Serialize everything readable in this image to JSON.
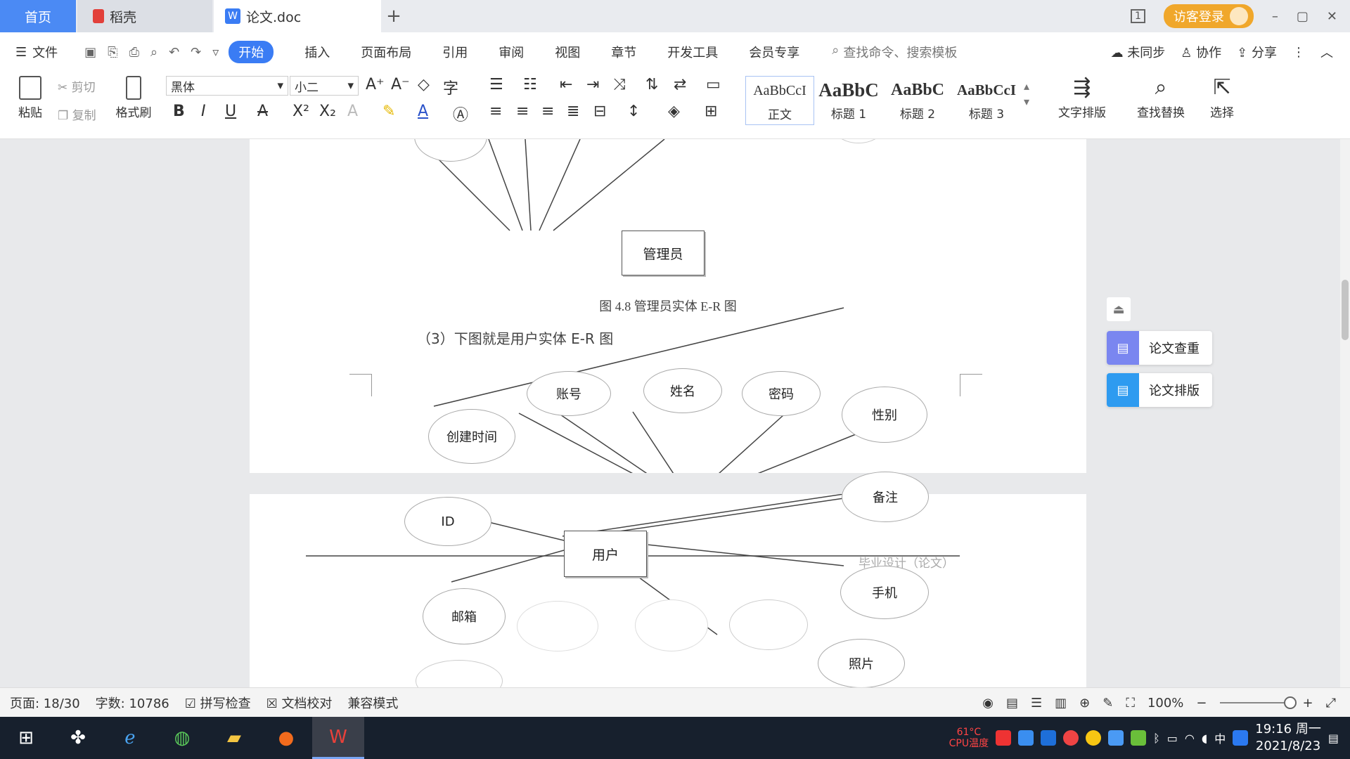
{
  "tabs": {
    "home": "首页",
    "daoke": "稻壳",
    "doc": "论文.doc",
    "add": "+",
    "doc_icon": "W"
  },
  "window": {
    "login": "访客登录",
    "layout_icon": "1",
    "minimize": "–",
    "restore": "▢",
    "close": "✕"
  },
  "menu": {
    "file": "文件",
    "start": "开始",
    "items": [
      "插入",
      "页面布局",
      "引用",
      "审阅",
      "视图",
      "章节",
      "开发工具",
      "会员专享"
    ],
    "search": "查找命令、搜索模板",
    "sync": "未同步",
    "collab": "协作",
    "share": "分享"
  },
  "ribbon": {
    "paste": "粘贴",
    "cut": "剪切",
    "copy": "复制",
    "format_painter": "格式刷",
    "font_name": "黑体",
    "font_size": "小二",
    "styles": [
      {
        "preview": "AaBbCcI",
        "label": "正文"
      },
      {
        "preview": "AaBbC",
        "label": "标题 1"
      },
      {
        "preview": "AaBbC",
        "label": "标题 2"
      },
      {
        "preview": "AaBbCcI",
        "label": "标题 3"
      }
    ],
    "text_layout": "文字排版",
    "find_replace": "查找替换",
    "select": "选择",
    "bold": "B",
    "italic": "I",
    "underline": "U",
    "superscript": "X²",
    "subscript": "X₂"
  },
  "document": {
    "admin_entity": "管理员",
    "fig_caption": "图 4.8  管理员实体 E-R 图",
    "para": "（3）下图就是用户实体 E-R 图",
    "user_entity": "用户",
    "attributes": {
      "account": "账号",
      "name": "姓名",
      "password": "密码",
      "gender": "性别",
      "created": "创建时间",
      "id": "ID",
      "remark": "备注",
      "phone": "手机",
      "email": "邮箱",
      "photo": "照片"
    },
    "header_text": "毕业设计（论文）"
  },
  "side_panel": {
    "check": "论文查重",
    "layout": "论文排版"
  },
  "status": {
    "page": "页面: 18/30",
    "words": "字数: 10786",
    "spell": "拼写检查",
    "proof": "文档校对",
    "compat": "兼容模式",
    "zoom": "100%",
    "zoom_level": 0.5
  },
  "taskbar": {
    "time": "19:16 周一",
    "date": "2021/8/23",
    "ime": "中",
    "temp": "61°C",
    "cpu": "CPU温度"
  }
}
